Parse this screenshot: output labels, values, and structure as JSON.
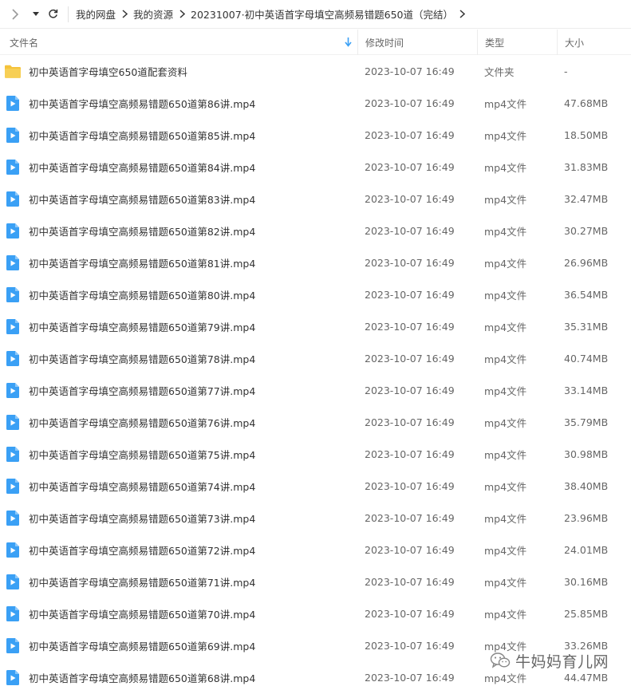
{
  "breadcrumb": [
    "我的网盘",
    "我的资源",
    "20231007·初中英语首字母填空高频易错题650道（完结）"
  ],
  "columns": {
    "name": "文件名",
    "time": "修改时间",
    "type": "类型",
    "size": "大小"
  },
  "colors": {
    "folder": "#f5c33b",
    "video": "#3aa0f5",
    "text": "#333333",
    "muted": "#666666"
  },
  "rows": [
    {
      "icon": "folder-icon",
      "name": "初中英语首字母填空650道配套资料",
      "time": "2023-10-07 16:49",
      "type": "文件夹",
      "size": "-"
    },
    {
      "icon": "video-file-icon",
      "name": "初中英语首字母填空高频易错题650道第86讲.mp4",
      "time": "2023-10-07 16:49",
      "type": "mp4文件",
      "size": "47.68MB"
    },
    {
      "icon": "video-file-icon",
      "name": "初中英语首字母填空高频易错题650道第85讲.mp4",
      "time": "2023-10-07 16:49",
      "type": "mp4文件",
      "size": "18.50MB"
    },
    {
      "icon": "video-file-icon",
      "name": "初中英语首字母填空高频易错题650道第84讲.mp4",
      "time": "2023-10-07 16:49",
      "type": "mp4文件",
      "size": "31.83MB"
    },
    {
      "icon": "video-file-icon",
      "name": "初中英语首字母填空高频易错题650道第83讲.mp4",
      "time": "2023-10-07 16:49",
      "type": "mp4文件",
      "size": "32.47MB"
    },
    {
      "icon": "video-file-icon",
      "name": "初中英语首字母填空高频易错题650道第82讲.mp4",
      "time": "2023-10-07 16:49",
      "type": "mp4文件",
      "size": "30.27MB"
    },
    {
      "icon": "video-file-icon",
      "name": "初中英语首字母填空高频易错题650道第81讲.mp4",
      "time": "2023-10-07 16:49",
      "type": "mp4文件",
      "size": "26.96MB"
    },
    {
      "icon": "video-file-icon",
      "name": "初中英语首字母填空高频易错题650道第80讲.mp4",
      "time": "2023-10-07 16:49",
      "type": "mp4文件",
      "size": "36.54MB"
    },
    {
      "icon": "video-file-icon",
      "name": "初中英语首字母填空高频易错题650道第79讲.mp4",
      "time": "2023-10-07 16:49",
      "type": "mp4文件",
      "size": "35.31MB"
    },
    {
      "icon": "video-file-icon",
      "name": "初中英语首字母填空高频易错题650道第78讲.mp4",
      "time": "2023-10-07 16:49",
      "type": "mp4文件",
      "size": "40.74MB"
    },
    {
      "icon": "video-file-icon",
      "name": "初中英语首字母填空高频易错题650道第77讲.mp4",
      "time": "2023-10-07 16:49",
      "type": "mp4文件",
      "size": "33.14MB"
    },
    {
      "icon": "video-file-icon",
      "name": "初中英语首字母填空高频易错题650道第76讲.mp4",
      "time": "2023-10-07 16:49",
      "type": "mp4文件",
      "size": "35.79MB"
    },
    {
      "icon": "video-file-icon",
      "name": "初中英语首字母填空高频易错题650道第75讲.mp4",
      "time": "2023-10-07 16:49",
      "type": "mp4文件",
      "size": "30.98MB"
    },
    {
      "icon": "video-file-icon",
      "name": "初中英语首字母填空高频易错题650道第74讲.mp4",
      "time": "2023-10-07 16:49",
      "type": "mp4文件",
      "size": "38.40MB"
    },
    {
      "icon": "video-file-icon",
      "name": "初中英语首字母填空高频易错题650道第73讲.mp4",
      "time": "2023-10-07 16:49",
      "type": "mp4文件",
      "size": "23.96MB"
    },
    {
      "icon": "video-file-icon",
      "name": "初中英语首字母填空高频易错题650道第72讲.mp4",
      "time": "2023-10-07 16:49",
      "type": "mp4文件",
      "size": "24.01MB"
    },
    {
      "icon": "video-file-icon",
      "name": "初中英语首字母填空高频易错题650道第71讲.mp4",
      "time": "2023-10-07 16:49",
      "type": "mp4文件",
      "size": "30.16MB"
    },
    {
      "icon": "video-file-icon",
      "name": "初中英语首字母填空高频易错题650道第70讲.mp4",
      "time": "2023-10-07 16:49",
      "type": "mp4文件",
      "size": "25.85MB"
    },
    {
      "icon": "video-file-icon",
      "name": "初中英语首字母填空高频易错题650道第69讲.mp4",
      "time": "2023-10-07 16:49",
      "type": "mp4文件",
      "size": "33.26MB"
    },
    {
      "icon": "video-file-icon",
      "name": "初中英语首字母填空高频易错题650道第68讲.mp4",
      "time": "2023-10-07 16:49",
      "type": "mp4文件",
      "size": "44.47MB"
    }
  ],
  "watermark": {
    "icon": "wechat-icon",
    "text": "牛妈妈育儿网"
  }
}
